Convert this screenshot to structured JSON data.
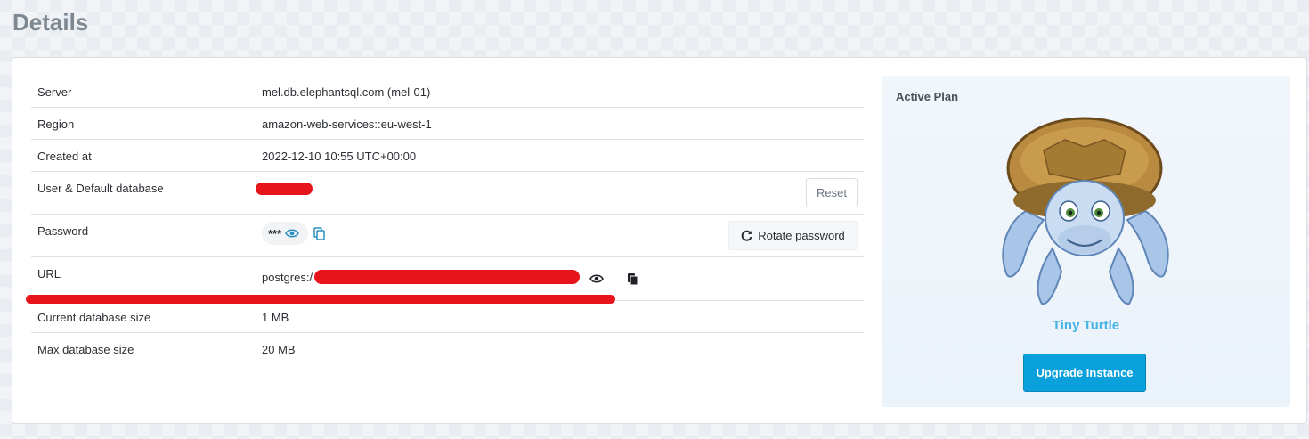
{
  "page": {
    "title": "Details"
  },
  "details": {
    "server": {
      "label": "Server",
      "value": "mel.db.elephantsql.com (mel-01)"
    },
    "region": {
      "label": "Region",
      "value": "amazon-web-services::eu-west-1"
    },
    "created": {
      "label": "Created at",
      "value": "2022-12-10 10:55 UTC+00:00"
    },
    "user": {
      "label": "User & Default database",
      "reset_label": "Reset"
    },
    "password": {
      "label": "Password",
      "masked": "***",
      "rotate_label": "Rotate password"
    },
    "url": {
      "label": "URL",
      "prefix": "postgres:/"
    },
    "current_size": {
      "label": "Current database size",
      "value": "1 MB"
    },
    "max_size": {
      "label": "Max database size",
      "value": "20 MB"
    }
  },
  "plan": {
    "label": "Active Plan",
    "name": "Tiny Turtle",
    "upgrade_label": "Upgrade Instance"
  },
  "icons": {
    "eye": "eye-icon",
    "copy": "copy-icon",
    "refresh": "refresh-icon"
  },
  "colors": {
    "accent": "#0aa0dc",
    "plan_name": "#46b3e6",
    "redaction": "#e8141b"
  }
}
